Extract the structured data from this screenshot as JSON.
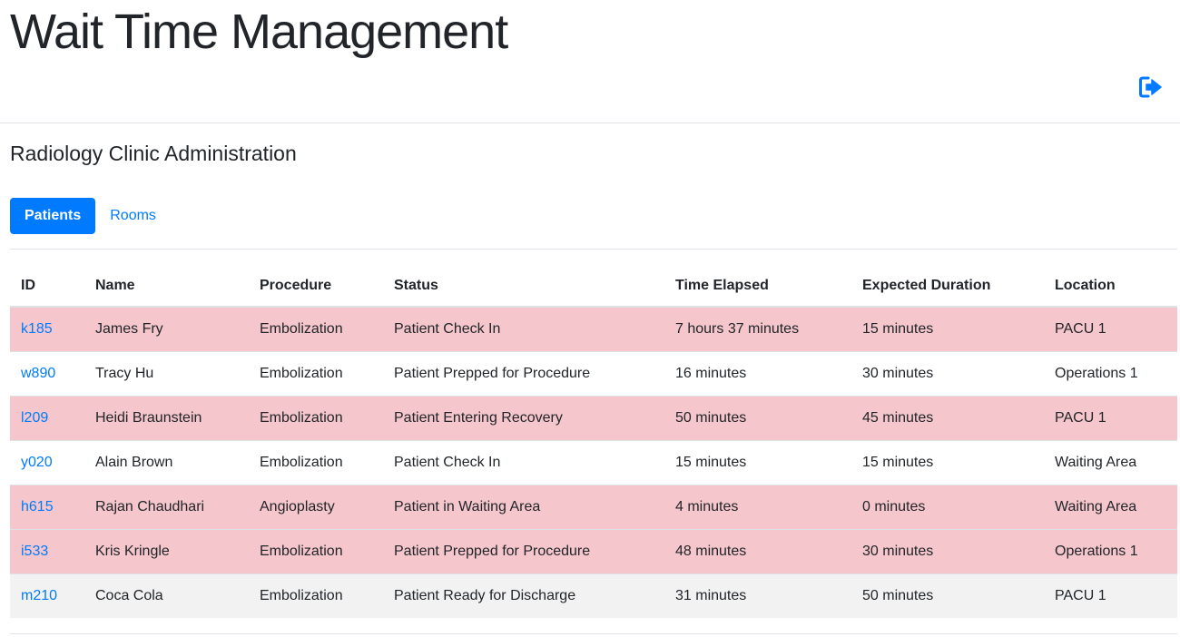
{
  "app": {
    "title": "Wait Time Management"
  },
  "header": {
    "logout_icon": "sign-out-icon",
    "accent": "#007bff"
  },
  "section": {
    "title": "Radiology Clinic Administration"
  },
  "tabs": [
    {
      "label": "Patients",
      "active": true
    },
    {
      "label": "Rooms",
      "active": false
    }
  ],
  "table": {
    "columns": [
      "ID",
      "Name",
      "Procedure",
      "Status",
      "Time Elapsed",
      "Expected Duration",
      "Location"
    ],
    "rows": [
      {
        "id": "k185",
        "name": "James Fry",
        "procedure": "Embolization",
        "status": "Patient Check In",
        "elapsed": "7 hours 37 minutes",
        "expected": "15 minutes",
        "location": "PACU 1",
        "highlight": "late"
      },
      {
        "id": "w890",
        "name": "Tracy Hu",
        "procedure": "Embolization",
        "status": "Patient Prepped for Procedure",
        "elapsed": "16 minutes",
        "expected": "30 minutes",
        "location": "Operations 1",
        "highlight": "normal"
      },
      {
        "id": "l209",
        "name": "Heidi Braunstein",
        "procedure": "Embolization",
        "status": "Patient Entering Recovery",
        "elapsed": "50 minutes",
        "expected": "45 minutes",
        "location": "PACU 1",
        "highlight": "late"
      },
      {
        "id": "y020",
        "name": "Alain Brown",
        "procedure": "Embolization",
        "status": "Patient Check In",
        "elapsed": "15 minutes",
        "expected": "15 minutes",
        "location": "Waiting Area",
        "highlight": "normal"
      },
      {
        "id": "h615",
        "name": "Rajan Chaudhari",
        "procedure": "Angioplasty",
        "status": "Patient in Waiting Area",
        "elapsed": "4 minutes",
        "expected": "0 minutes",
        "location": "Waiting Area",
        "highlight": "late"
      },
      {
        "id": "i533",
        "name": "Kris Kringle",
        "procedure": "Embolization",
        "status": "Patient Prepped for Procedure",
        "elapsed": "48 minutes",
        "expected": "30 minutes",
        "location": "Operations 1",
        "highlight": "late"
      },
      {
        "id": "m210",
        "name": "Coca Cola",
        "procedure": "Embolization",
        "status": "Patient Ready for Discharge",
        "elapsed": "31 minutes",
        "expected": "50 minutes",
        "location": "PACU 1",
        "highlight": "discharge"
      }
    ]
  },
  "colors": {
    "late_row": "#f5c6cb",
    "discharge_row": "#f2f2f2",
    "link": "#007bff"
  }
}
